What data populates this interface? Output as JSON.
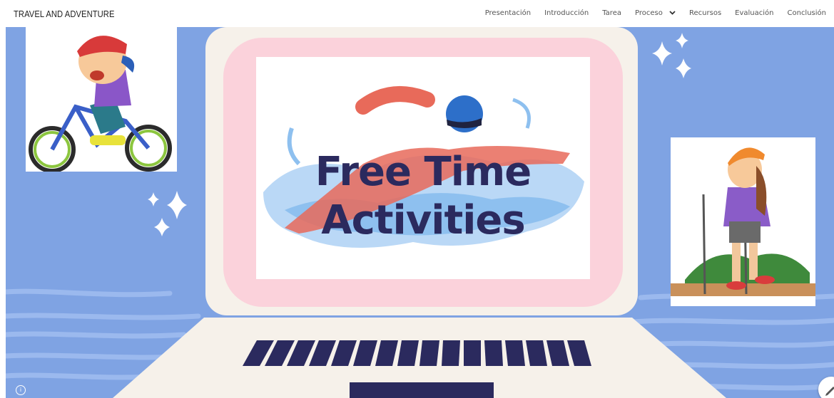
{
  "header": {
    "site_title": "TRAVEL AND ADVENTURE",
    "nav": [
      {
        "label": "Presentación"
      },
      {
        "label": "Introducción"
      },
      {
        "label": "Tarea"
      },
      {
        "label": "Proceso",
        "has_dropdown": true
      },
      {
        "label": "Recursos"
      },
      {
        "label": "Evaluación"
      },
      {
        "label": "Conclusión"
      }
    ]
  },
  "hero": {
    "slide_title_line1": "Free Time",
    "slide_title_line2": "Activities",
    "icons": [
      "sparkle-icon",
      "info-icon",
      "edit-pencil-icon",
      "chevron-down-icon"
    ]
  },
  "colors": {
    "background_blue": "#7fa3e3",
    "wave_blue": "#9bb9ee",
    "laptop_cream": "#f6f1ea",
    "screen_pink": "#fbd2db",
    "keys_navy": "#2b2a5e",
    "title_navy": "#2b2a5e"
  }
}
